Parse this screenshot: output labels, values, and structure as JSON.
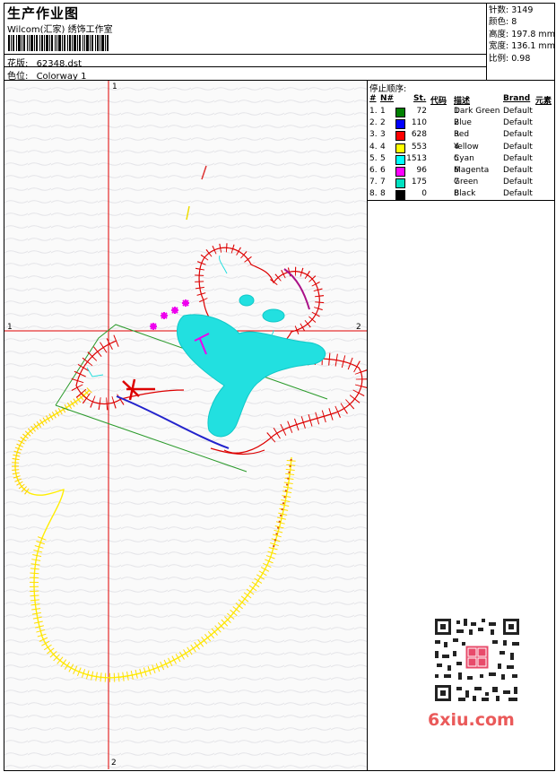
{
  "header": {
    "title": "生产作业图",
    "studio": "Wilcom(汇家) 绣饰工作室",
    "pattern_label": "花版:",
    "pattern_value": "62348.dst",
    "colorway_label": "色位:",
    "colorway_value": "Colorway 1"
  },
  "stats": {
    "stitches": "针数: 3149",
    "colors": "颜色: 8",
    "height": "高度: 197.8 mm",
    "width": "宽度: 136.1 mm",
    "scale": "比例: 0.98"
  },
  "legend": {
    "title": "停止顺序:",
    "columns": [
      "#",
      "N#",
      "St.",
      "代码",
      "描述",
      "Brand",
      "元素"
    ],
    "rows": [
      {
        "idx": "1.",
        "n": "1",
        "color": "#008000",
        "st": "72",
        "code": "1",
        "desc": "Dark Green",
        "brand": "Default"
      },
      {
        "idx": "2.",
        "n": "2",
        "color": "#0000ff",
        "st": "110",
        "code": "2",
        "desc": "Blue",
        "brand": "Default"
      },
      {
        "idx": "3.",
        "n": "3",
        "color": "#ff0000",
        "st": "628",
        "code": "3",
        "desc": "Red",
        "brand": "Default"
      },
      {
        "idx": "4.",
        "n": "4",
        "color": "#ffff00",
        "st": "553",
        "code": "4",
        "desc": "Yellow",
        "brand": "Default"
      },
      {
        "idx": "5.",
        "n": "5",
        "color": "#00ffff",
        "st": "1513",
        "code": "5",
        "desc": "Cyan",
        "brand": "Default"
      },
      {
        "idx": "6.",
        "n": "6",
        "color": "#ff00ff",
        "st": "96",
        "code": "6",
        "desc": "Magenta",
        "brand": "Default"
      },
      {
        "idx": "7.",
        "n": "7",
        "color": "#00e0c0",
        "st": "175",
        "code": "7",
        "desc": "Green",
        "brand": "Default"
      },
      {
        "idx": "8.",
        "n": "8",
        "color": "#000000",
        "st": "0",
        "code": "8",
        "desc": "Black",
        "brand": "Default"
      }
    ]
  },
  "axes": {
    "top": "1",
    "left": "1",
    "right": "2",
    "bottom": "2"
  },
  "watermark": {
    "text": "6xiu.com"
  }
}
